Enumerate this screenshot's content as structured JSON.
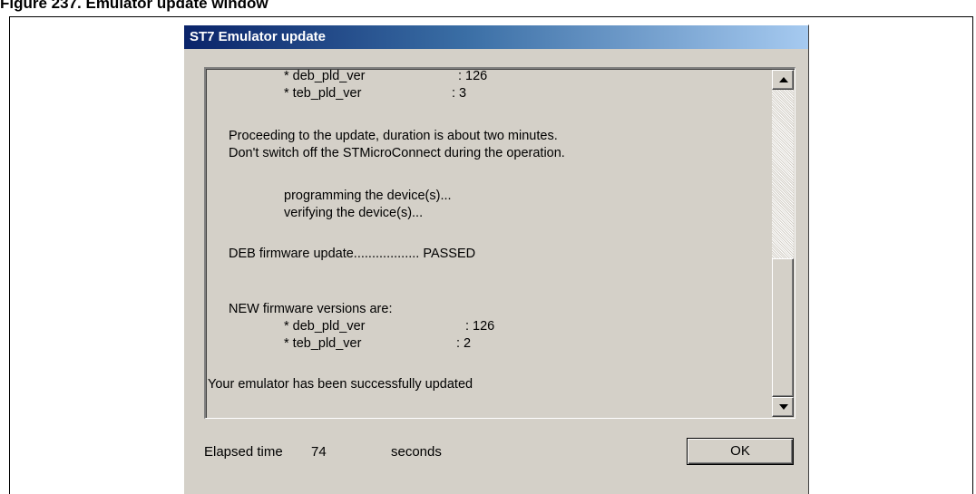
{
  "figure_caption": "Figure 237. Emulator update window",
  "window": {
    "title": "ST7 Emulator update"
  },
  "log": {
    "old_deb_label": "* deb_pld_ver",
    "old_deb_value": ": 126",
    "old_teb_label": "* teb_pld_ver",
    "old_teb_value": ": 3",
    "proceeding": "Proceeding to the update, duration is about two minutes.",
    "dont_switch": "Don't switch off the STMicroConnect during the operation.",
    "programming": "programming the device(s)...",
    "verifying": "verifying the device(s)...",
    "deb_update": "DEB firmware update.................. PASSED",
    "new_versions": "NEW firmware versions are:",
    "new_deb_label": "* deb_pld_ver",
    "new_deb_value": ": 126",
    "new_teb_label": "* teb_pld_ver",
    "new_teb_value": ": 2",
    "success": "Your emulator has been successfully updated"
  },
  "status": {
    "elapsed_label": "Elapsed time",
    "elapsed_value": "74",
    "elapsed_unit": "seconds"
  },
  "buttons": {
    "ok_label": "OK"
  },
  "icons": {
    "scroll_up": "scroll-up-arrow-icon",
    "scroll_down": "scroll-down-arrow-icon"
  }
}
